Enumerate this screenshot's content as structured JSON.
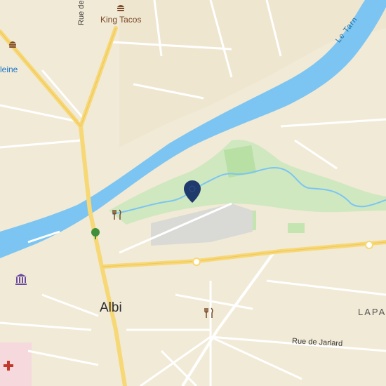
{
  "map": {
    "city_label": "Albi",
    "river_label": "Le Tarn",
    "poi_king_tacos": "King Tacos",
    "street_jarlard": "Rue de Jarlard",
    "street_rue_partial": "Rue de",
    "district_partial": "LAPA",
    "place_partial": "leine",
    "colors": {
      "land": "#f1ead6",
      "water": "#7cc5f2",
      "park": "#cfe8c0",
      "major_road": "#f7d876",
      "minor_road": "#ffffff",
      "pin": "#1f3a6b",
      "hospital": "#c0392b"
    },
    "icons": [
      "burger-icon",
      "burger-icon",
      "restaurant-icon",
      "restaurant-icon",
      "tree-icon",
      "museum-icon",
      "hospital-icon",
      "location-pin-icon"
    ]
  }
}
